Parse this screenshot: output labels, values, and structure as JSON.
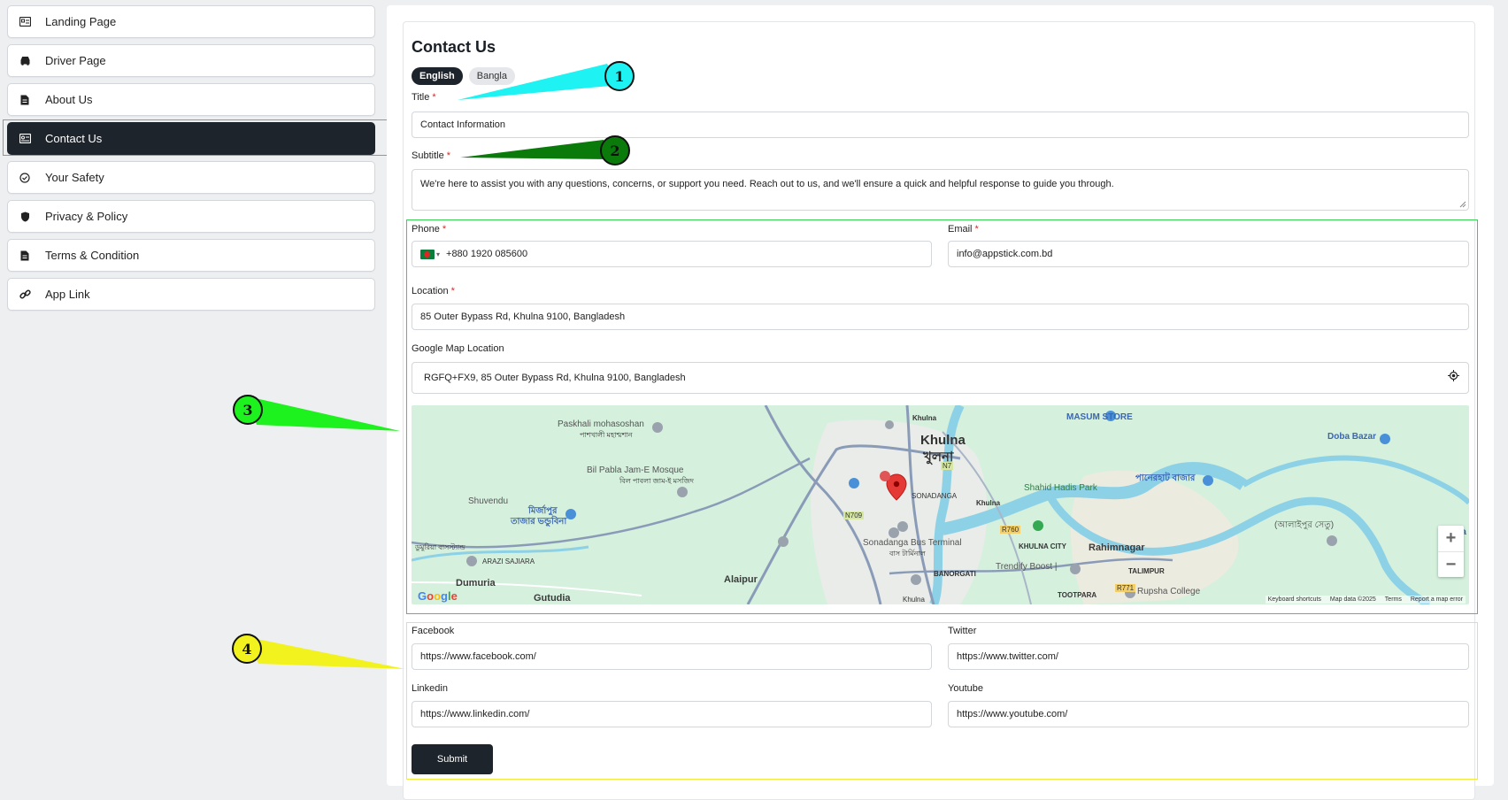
{
  "sidebar": {
    "items": [
      {
        "label": "Landing Page",
        "icon": "landing-icon"
      },
      {
        "label": "Driver Page",
        "icon": "car-icon"
      },
      {
        "label": "About Us",
        "icon": "document-icon"
      },
      {
        "label": "Contact Us",
        "icon": "contact-card-icon",
        "active": true
      },
      {
        "label": "Your Safety",
        "icon": "shield-check-icon"
      },
      {
        "label": "Privacy & Policy",
        "icon": "shield-icon"
      },
      {
        "label": "Terms & Condition",
        "icon": "document-icon"
      },
      {
        "label": "App Link",
        "icon": "link-icon"
      }
    ]
  },
  "page": {
    "title": "Contact Us",
    "tabs": [
      {
        "label": "English",
        "active": true
      },
      {
        "label": "Bangla",
        "active": false
      }
    ]
  },
  "form": {
    "title_label": "Title",
    "title_value": "Contact Information",
    "subtitle_label": "Subtitle",
    "subtitle_value": "We're here to assist you with any questions, concerns, or support you need. Reach out to us, and we'll ensure a quick and helpful response to guide you through.",
    "phone_label": "Phone",
    "phone_value": "+880 1920 085600",
    "email_label": "Email",
    "email_value": "info@appstick.com.bd",
    "location_label": "Location",
    "location_value": "85 Outer Bypass Rd, Khulna 9100, Bangladesh",
    "gmap_label": "Google Map Location",
    "gmap_value": "RGFQ+FX9, 85 Outer Bypass Rd, Khulna 9100, Bangladesh",
    "facebook_label": "Facebook",
    "facebook_value": "https://www.facebook.com/",
    "twitter_label": "Twitter",
    "twitter_value": "https://www.twitter.com/",
    "linkedin_label": "Linkedin",
    "linkedin_value": "https://www.linkedin.com/",
    "youtube_label": "Youtube",
    "youtube_value": "https://www.youtube.com/",
    "submit_label": "Submit",
    "required_mark": "*"
  },
  "map": {
    "labels": {
      "khulna_en": "Khulna",
      "khulna_bn": "খুলনা",
      "paskhali": "Paskhali mohasoshan",
      "paskhali_bn": "পাশখালী মহাশ্মশান",
      "bil_pabla": "Bil Pabla Jam-E Mosque",
      "bil_pabla_bn": "বিল পাবলা জাম-ই মসজিদ",
      "shuvendu": "Shuvendu",
      "mirjapur": "মির্জাপুর",
      "mirjapur2": "তাজার ভন্ডুবিনা",
      "arazi": "ARAZI SAJIARA",
      "dumuria": "Dumuria",
      "gutudia": "Gutudia",
      "alaipur": "Alaipur",
      "sonadanga_bus": "Sonadanga Bus Terminal",
      "sonadanga_bus_bn": "বাস টার্মিনাল",
      "banorgati": "BANORGATI",
      "khulna_city": "KHULNA CITY",
      "shahid_hadis": "Shahid Hadis Park",
      "rahimnagar": "Rahimnagar",
      "talimpur": "TALIMPUR",
      "trendify": "Trendify Boost |",
      "rupsha": "Rupsha College",
      "masum": "MASUM STORE",
      "doba": "Doba Bazar",
      "panerhat": "পানেরহাট বাজার",
      "alaipur_bridge": "(আলাইপুর সেতু)",
      "tootpara": "TOOTPARA",
      "khulna_small": "Khulna",
      "khulna_bottom": "Khulna",
      "sonadanga": "SONADANGA",
      "dumuria_bn": "ডুমুরিয়া বাসস্ট্যান্ড",
      "road_n7": "N7",
      "road_n709": "N709",
      "road_r760": "R760",
      "road_r771": "R771",
      "ma": "Ma"
    },
    "attribution": [
      "Keyboard shortcuts",
      "Map data ©2025",
      "Terms",
      "Report a map error"
    ],
    "google": [
      "G",
      "o",
      "o",
      "g",
      "l",
      "e"
    ],
    "zoom_in": "+",
    "zoom_out": "−",
    "colors": {
      "land": "#d5f0dd",
      "water": "#8dd1e6",
      "road": "#8a9bb8",
      "pin": "#e53935"
    }
  },
  "annotations": [
    "1",
    "2",
    "3",
    "4"
  ]
}
